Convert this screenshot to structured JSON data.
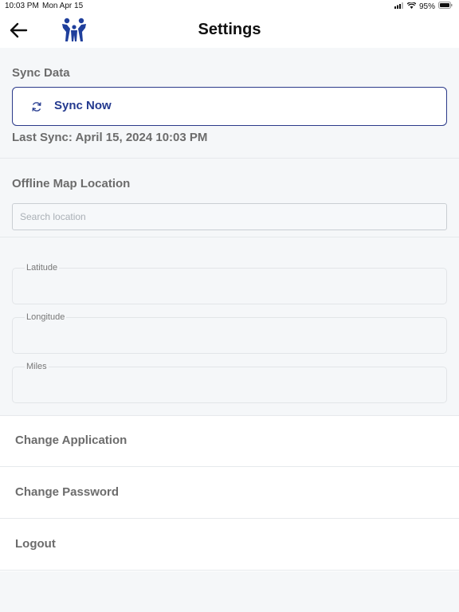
{
  "status_bar": {
    "time": "10:03 PM",
    "date": "Mon Apr 15",
    "battery": "95%",
    "icons": [
      "signal-icon",
      "wifi-icon",
      "battery-icon"
    ]
  },
  "nav": {
    "title": "Settings",
    "back_icon": "arrow-left-icon",
    "logo": "family-logo"
  },
  "sync": {
    "section_title": "Sync Data",
    "button_label": "Sync Now",
    "button_icon": "sync-icon",
    "last_sync": "Last Sync: April 15, 2024 10:03 PM"
  },
  "offline_map": {
    "section_title": "Offline Map Location",
    "search_placeholder": "Search location",
    "fields": [
      {
        "label": "Latitude",
        "value": ""
      },
      {
        "label": "Longitude",
        "value": ""
      },
      {
        "label": "Miles",
        "value": ""
      }
    ]
  },
  "menu": {
    "items": [
      {
        "label": "Change Application"
      },
      {
        "label": "Change Password"
      },
      {
        "label": "Logout"
      }
    ]
  },
  "colors": {
    "accent": "#243a8f",
    "muted_text": "#6c6c6c",
    "background": "#f5f7f9"
  }
}
